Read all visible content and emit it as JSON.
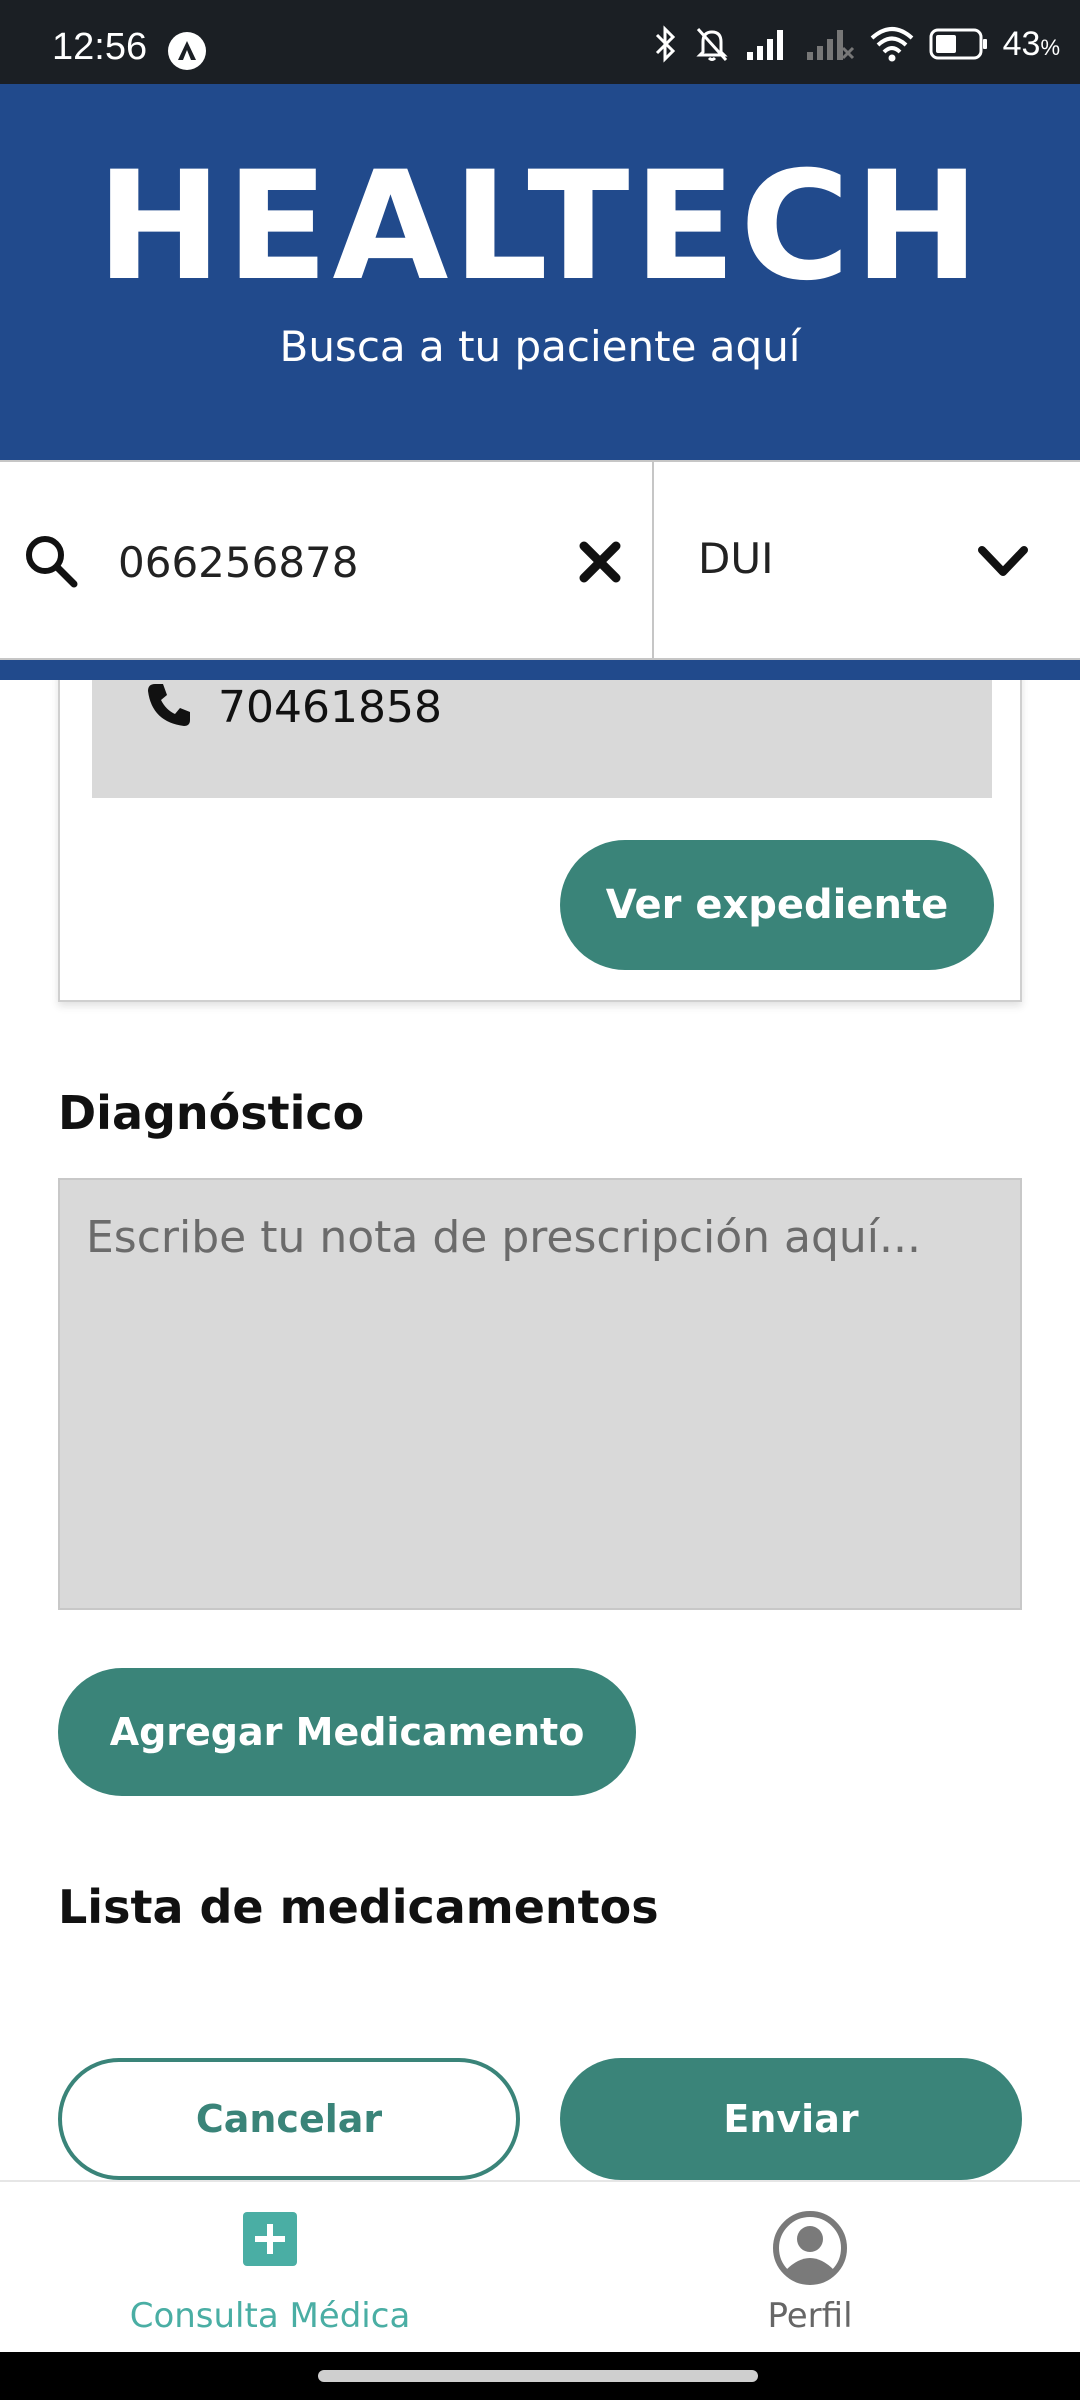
{
  "status_bar": {
    "time": "12:56",
    "battery_percent": "43",
    "battery_unit": "%",
    "icons": [
      "app-notification-icon",
      "bluetooth-icon",
      "mute-icon",
      "signal-icon",
      "signal-no-sim-icon",
      "wifi-icon",
      "battery-icon"
    ]
  },
  "header": {
    "brand": "HEALTECH",
    "subtitle": "Busca a tu paciente aquí"
  },
  "search": {
    "value": "066256878",
    "id_type": "DUI"
  },
  "patient_card": {
    "phone": "70461858",
    "view_record_label": "Ver expediente"
  },
  "diagnosis": {
    "title": "Diagnóstico",
    "placeholder": "Escribe tu nota de prescripción aquí..."
  },
  "medications": {
    "add_button_label": "Agregar Medicamento",
    "list_title": "Lista de medicamentos"
  },
  "actions": {
    "cancel_label": "Cancelar",
    "send_label": "Enviar"
  },
  "bottom_nav": {
    "items": [
      {
        "label": "Consulta Médica",
        "icon": "medical-plus-icon",
        "active": true
      },
      {
        "label": "Perfil",
        "icon": "profile-icon",
        "active": false
      }
    ]
  },
  "colors": {
    "header_blue": "#214a8c",
    "primary_green": "#3a8479",
    "active_nav": "#4aaea4",
    "field_gray": "#d9d9d9"
  }
}
